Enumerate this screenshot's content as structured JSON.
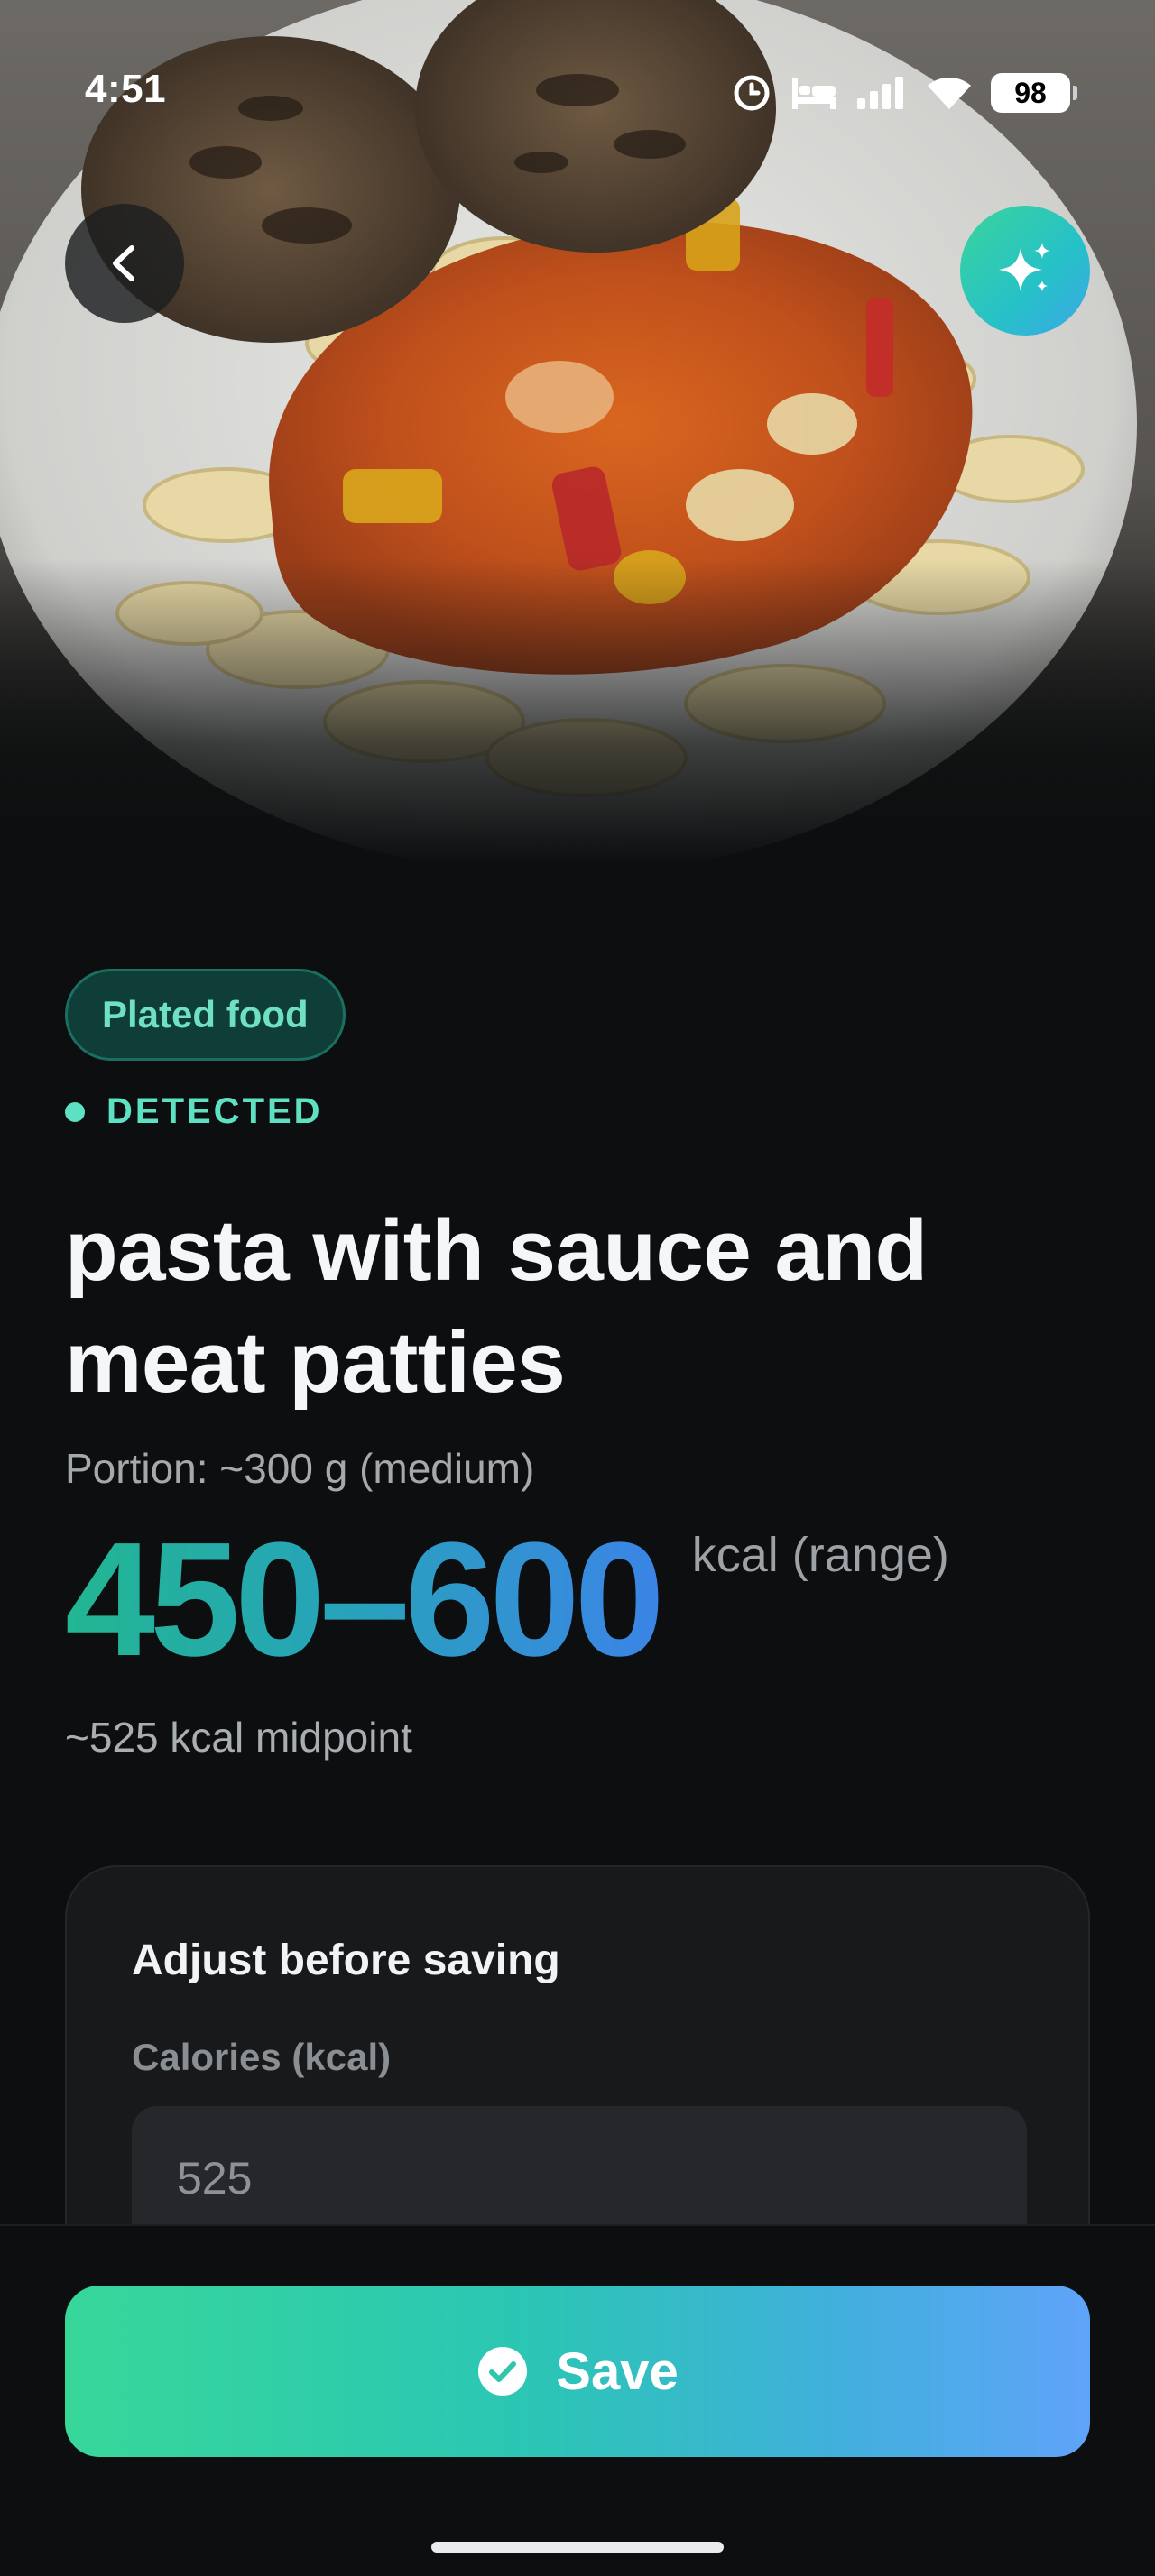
{
  "status_bar": {
    "time": "4:51",
    "battery": "98",
    "icons": [
      "alarm-icon",
      "sleep-bed-icon",
      "signal-icon",
      "wifi-icon",
      "battery-icon"
    ]
  },
  "hero": {
    "back_icon": "chevron-left-icon",
    "ai_icon": "sparkles-icon"
  },
  "result": {
    "category_chip": "Plated food",
    "detected_label": "DETECTED",
    "food_name": "pasta with sauce and meat patties",
    "portion": "Portion: ~300 g (medium)",
    "kcal_range": "450–600",
    "kcal_unit": "kcal (range)",
    "midpoint": "~525 kcal midpoint"
  },
  "adjust": {
    "title": "Adjust before saving",
    "calories_label": "Calories (kcal)",
    "calories_placeholder": "525",
    "calories_value": ""
  },
  "actions": {
    "save_label": "Save",
    "save_icon": "check-circle-icon"
  },
  "colors": {
    "background": "#0c0e0f",
    "accent_teal": "#5ee0c2",
    "gradient_start": "#37d79a",
    "gradient_end": "#5fa3f8",
    "card": "#17191b"
  }
}
